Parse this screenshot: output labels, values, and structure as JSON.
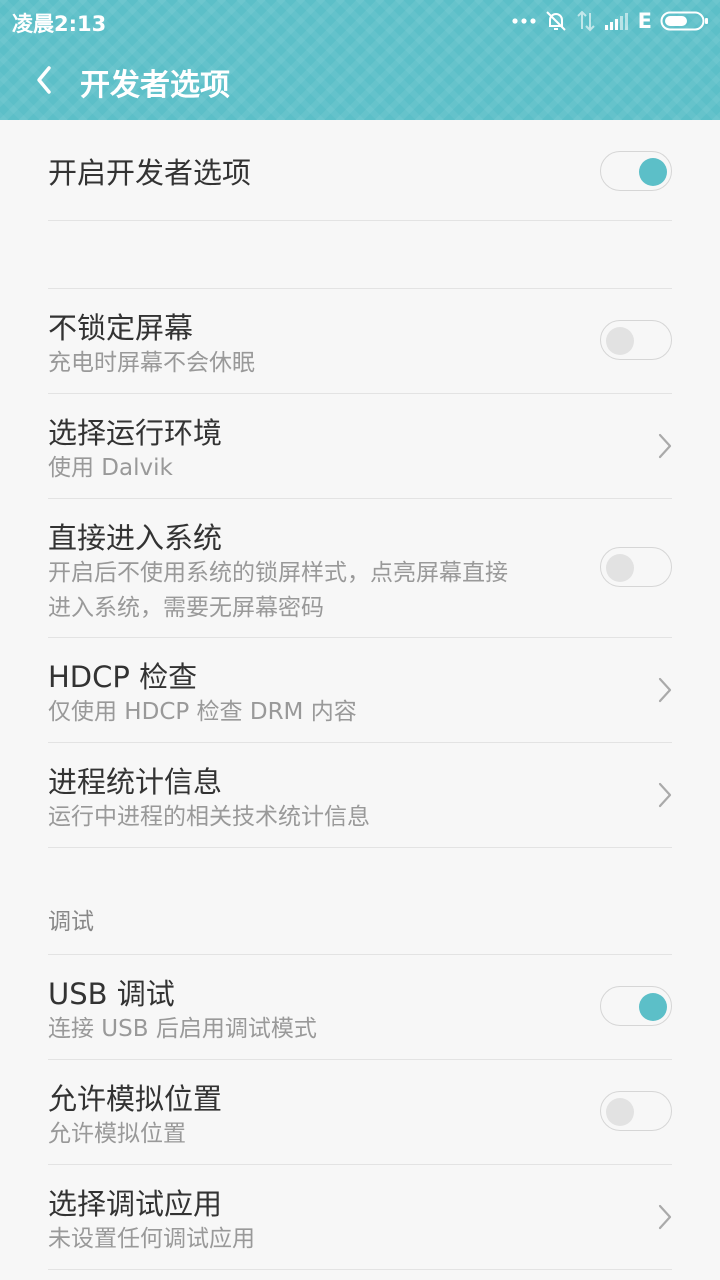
{
  "status_bar": {
    "time": "凌晨2:13",
    "network_type": "E",
    "icons": [
      "more-dots-icon",
      "alarm-off-icon",
      "data-transfer-icon",
      "signal-icon",
      "battery-icon"
    ]
  },
  "header": {
    "title": "开发者选项",
    "back_icon": "chevron-left-icon",
    "accent_color": "#5cbfc8"
  },
  "master": {
    "title": "开启开发者选项",
    "enabled": true
  },
  "items": [
    {
      "title": "不锁定屏幕",
      "subtitle": "充电时屏幕不会休眠",
      "control": "toggle",
      "enabled": false
    },
    {
      "title": "选择运行环境",
      "subtitle": "使用 Dalvik",
      "control": "chevron"
    },
    {
      "title": "直接进入系统",
      "subtitle": "开启后不使用系统的锁屏样式，点亮屏幕直接",
      "subtitle2": "进入系统，需要无屏幕密码",
      "control": "toggle",
      "enabled": false
    },
    {
      "title": "HDCP 检查",
      "subtitle": "仅使用 HDCP 检查 DRM 内容",
      "control": "chevron"
    },
    {
      "title": "进程统计信息",
      "subtitle": "运行中进程的相关技术统计信息",
      "control": "chevron"
    }
  ],
  "debug_section": {
    "label": "调试",
    "items": [
      {
        "title": "USB 调试",
        "subtitle": "连接 USB 后启用调试模式",
        "control": "toggle",
        "enabled": true
      },
      {
        "title": "允许模拟位置",
        "subtitle": "允许模拟位置",
        "control": "toggle",
        "enabled": false
      },
      {
        "title": "选择调试应用",
        "subtitle": "未设置任何调试应用",
        "control": "chevron"
      }
    ]
  }
}
